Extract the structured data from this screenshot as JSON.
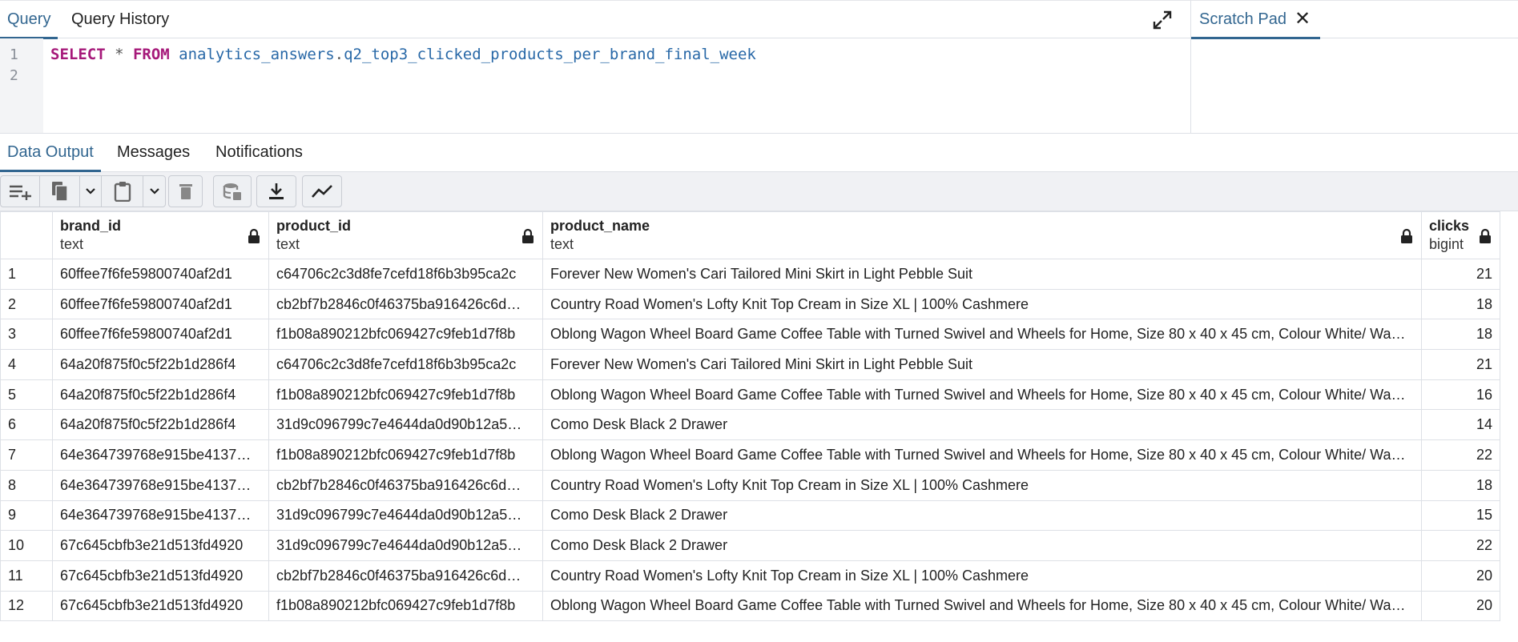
{
  "query_tabs": {
    "query": "Query",
    "history": "Query History"
  },
  "scratch": {
    "title": "Scratch Pad"
  },
  "editor": {
    "line_numbers": [
      "1",
      "2"
    ],
    "sql": {
      "kw1": "SELECT",
      "star": " * ",
      "kw2": "FROM",
      "schema": " analytics_answers",
      "dot": ".",
      "table": "q2_top3_clicked_products_per_brand_final_week"
    }
  },
  "output_tabs": {
    "data_output": "Data Output",
    "messages": "Messages",
    "notifications": "Notifications"
  },
  "toolbar": {
    "icons": [
      "add-row-icon",
      "copy-icon",
      "chevron-down-icon",
      "paste-icon",
      "chevron-down-icon",
      "delete-icon",
      "save-data-icon",
      "download-icon",
      "graph-visualiser-icon"
    ]
  },
  "grid": {
    "columns": [
      {
        "name": "brand_id",
        "type": "text"
      },
      {
        "name": "product_id",
        "type": "text"
      },
      {
        "name": "product_name",
        "type": "text"
      },
      {
        "name": "clicks",
        "type": "bigint"
      }
    ],
    "rows": [
      {
        "n": "1",
        "brand_id": "60ffee7f6fe59800740af2d1",
        "product_id": "c64706c2c3d8fe7cefd18f6b3b95ca2c",
        "product_name": "Forever New Women's Cari Tailored Mini Skirt in Light Pebble Suit",
        "clicks": "21"
      },
      {
        "n": "2",
        "brand_id": "60ffee7f6fe59800740af2d1",
        "product_id": "cb2bf7b2846c0f46375ba916426c6d…",
        "product_name": "Country Road Women's Lofty Knit Top Cream in Size XL | 100% Cashmere",
        "clicks": "18"
      },
      {
        "n": "3",
        "brand_id": "60ffee7f6fe59800740af2d1",
        "product_id": "f1b08a890212bfc069427c9feb1d7f8b",
        "product_name": "Oblong Wagon Wheel Board Game Coffee Table with Turned Swivel and Wheels for Home, Size 80 x 40 x 45 cm, Colour White/ Wa…",
        "clicks": "18"
      },
      {
        "n": "4",
        "brand_id": "64a20f875f0c5f22b1d286f4",
        "product_id": "c64706c2c3d8fe7cefd18f6b3b95ca2c",
        "product_name": "Forever New Women's Cari Tailored Mini Skirt in Light Pebble Suit",
        "clicks": "21"
      },
      {
        "n": "5",
        "brand_id": "64a20f875f0c5f22b1d286f4",
        "product_id": "f1b08a890212bfc069427c9feb1d7f8b",
        "product_name": "Oblong Wagon Wheel Board Game Coffee Table with Turned Swivel and Wheels for Home, Size 80 x 40 x 45 cm, Colour White/ Wa…",
        "clicks": "16"
      },
      {
        "n": "6",
        "brand_id": "64a20f875f0c5f22b1d286f4",
        "product_id": "31d9c096799c7e4644da0d90b12a5…",
        "product_name": "Como Desk Black 2 Drawer",
        "clicks": "14"
      },
      {
        "n": "7",
        "brand_id": "64e364739768e915be4137…",
        "product_id": "f1b08a890212bfc069427c9feb1d7f8b",
        "product_name": "Oblong Wagon Wheel Board Game Coffee Table with Turned Swivel and Wheels for Home, Size 80 x 40 x 45 cm, Colour White/ Wa…",
        "clicks": "22"
      },
      {
        "n": "8",
        "brand_id": "64e364739768e915be4137…",
        "product_id": "cb2bf7b2846c0f46375ba916426c6d…",
        "product_name": "Country Road Women's Lofty Knit Top Cream in Size XL | 100% Cashmere",
        "clicks": "18"
      },
      {
        "n": "9",
        "brand_id": "64e364739768e915be4137…",
        "product_id": "31d9c096799c7e4644da0d90b12a5…",
        "product_name": "Como Desk Black 2 Drawer",
        "clicks": "15"
      },
      {
        "n": "10",
        "brand_id": "67c645cbfb3e21d513fd4920",
        "product_id": "31d9c096799c7e4644da0d90b12a5…",
        "product_name": "Como Desk Black 2 Drawer",
        "clicks": "22"
      },
      {
        "n": "11",
        "brand_id": "67c645cbfb3e21d513fd4920",
        "product_id": "cb2bf7b2846c0f46375ba916426c6d…",
        "product_name": "Country Road Women's Lofty Knit Top Cream in Size XL | 100% Cashmere",
        "clicks": "20"
      },
      {
        "n": "12",
        "brand_id": "67c645cbfb3e21d513fd4920",
        "product_id": "f1b08a890212bfc069427c9feb1d7f8b",
        "product_name": "Oblong Wagon Wheel Board Game Coffee Table with Turned Swivel and Wheels for Home, Size 80 x 40 x 45 cm, Colour White/ Wa…",
        "clicks": "20"
      }
    ]
  },
  "colors": {
    "accent": "#326690",
    "keyword": "#a6197a",
    "identifier": "#2868a7",
    "toolbar_bg": "#f0f1f4",
    "border": "#dde0e6"
  }
}
